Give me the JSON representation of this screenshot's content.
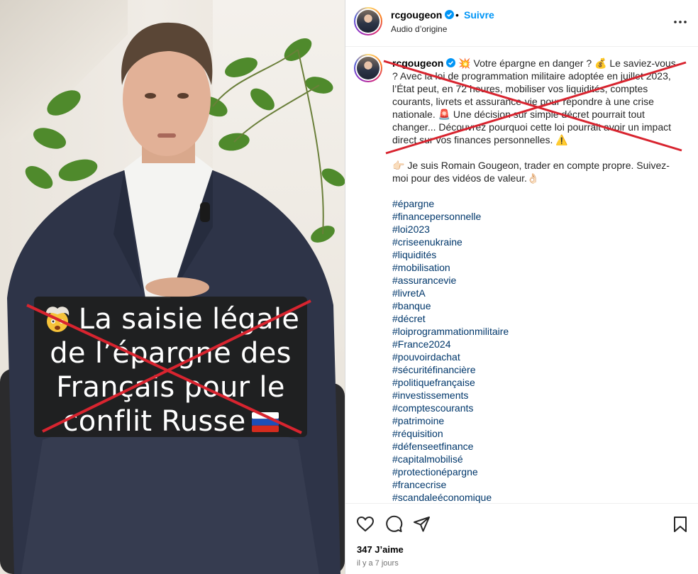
{
  "post": {
    "username": "rcgougeon",
    "follow_label": "Suivre",
    "separator": "•",
    "audio_label": "Audio d’origine",
    "caption": {
      "username": "rcgougeon",
      "paragraph1": " 💥 Votre épargne en danger ? 💰 Le saviez-vous ? Avec la loi de programmation militaire adoptée en juillet 2023, l’État peut, en 72 heures, mobiliser vos liquidités, comptes courants, livrets et assurance-vie pour répondre à une crise nationale. 🚨 Une décision sur simple décret pourrait tout changer... Découvrez pourquoi cette loi pourrait avoir un impact direct sur vos finances personnelles. ⚠️",
      "paragraph2": "👉🏻 Je suis Romain Gougeon, trader en compte propre. Suivez-moi pour des vidéos de valeur.👌🏻",
      "hashtags": [
        "#épargne",
        "#financepersonnelle",
        "#loi2023",
        "#criseenukraine",
        "#liquidités",
        "#mobilisation",
        "#assurancevie",
        "#livretA",
        "#banque",
        "#décret",
        "#loiprogrammationmilitaire",
        "#France2024",
        "#pouvoirdachat",
        "#sécuritéfinancière",
        "#politiquefrançaise",
        "#investissements",
        "#comptescourants",
        "#patrimoine",
        "#réquisition",
        "#défenseetfinance",
        "#capitalmobilisé",
        "#protectionépargne",
        "#francecrise",
        "#scandaleéconomique"
      ]
    },
    "likes": "347 J’aime",
    "time_ago": "il y a 7 jours"
  },
  "media": {
    "overlay_line1": "La saisie légale",
    "overlay_line2": "de l’épargne des",
    "overlay_line3": "Français  pour le",
    "overlay_line4": "conflit Russe",
    "overlay_emoji": "exploding-head-emoji",
    "overlay_flag": "russian-flag-emoji"
  },
  "icons": {
    "more": "more-horizontal-icon",
    "like": "heart-icon",
    "comment": "comment-icon",
    "share": "paper-plane-icon",
    "save": "bookmark-icon",
    "verified": "verified-badge-icon"
  },
  "colors": {
    "follow": "#0095f6",
    "hashtag": "#00376b",
    "strike": "#d8242f",
    "verified": "#0095f6"
  }
}
